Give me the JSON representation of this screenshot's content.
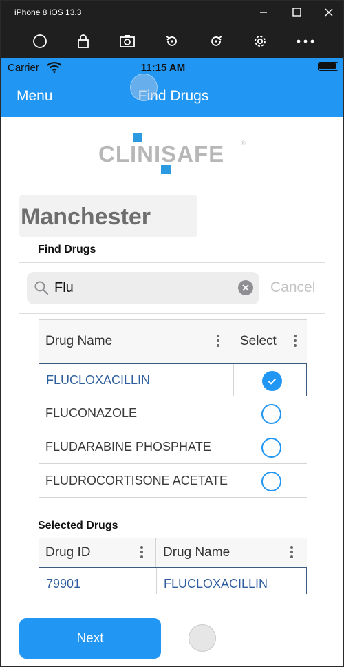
{
  "window": {
    "title": "iPhone 8 iOS 13.3",
    "controls": [
      "minimize-icon",
      "maximize-icon",
      "close-icon"
    ],
    "toolbar_icons": [
      "home-icon",
      "lock-icon",
      "camera-icon",
      "rotate-left-icon",
      "rotate-right-icon",
      "gear-icon",
      "more-icon"
    ]
  },
  "status_bar": {
    "carrier": "Carrier",
    "time": "11:15 AM"
  },
  "nav": {
    "menu_label": "Menu",
    "title": "Find Drugs"
  },
  "logo": {
    "text": "CLINISAFE",
    "reg": "®"
  },
  "site": {
    "label": "Manchester"
  },
  "find_section": {
    "title": "Find Drugs"
  },
  "search": {
    "value": "Flu",
    "placeholder": "",
    "cancel_label": "Cancel"
  },
  "drug_grid": {
    "columns": [
      "Drug Name",
      "Select"
    ],
    "rows": [
      {
        "name": "FLUCLOXACILLIN",
        "selected": true
      },
      {
        "name": "FLUCONAZOLE",
        "selected": false
      },
      {
        "name": "FLUDARABINE PHOSPHATE",
        "selected": false
      },
      {
        "name": "FLUDROCORTISONE ACETATE",
        "selected": false
      }
    ]
  },
  "selected_section": {
    "title": "Selected Drugs"
  },
  "selected_grid": {
    "columns": [
      "Drug ID",
      "Drug Name"
    ],
    "rows": [
      {
        "id": "79901",
        "name": "FLUCLOXACILLIN"
      }
    ]
  },
  "footer": {
    "next_label": "Next"
  },
  "colors": {
    "accent": "#2196f3",
    "chrome": "#1f1f1f",
    "logo_grey": "#b7b7b7",
    "row_text_blue": "#2f5e9e"
  }
}
